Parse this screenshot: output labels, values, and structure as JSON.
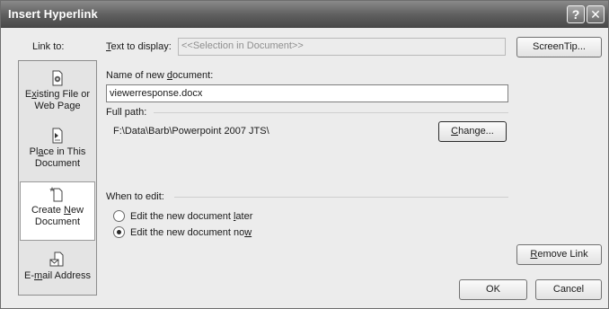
{
  "window": {
    "title": "Insert Hyperlink",
    "help_glyph": "?",
    "close_glyph": "✕"
  },
  "link_to": {
    "label": "Link to:",
    "items": [
      {
        "label_lines": [
          "Existing File or",
          "Web Page"
        ],
        "underline_char": "x",
        "icon": "existing-file-icon",
        "selected": false
      },
      {
        "label_lines": [
          "Place in This",
          "Document"
        ],
        "underline_char": "a",
        "icon": "place-in-document-icon",
        "selected": false
      },
      {
        "label_lines": [
          "Create New",
          "Document"
        ],
        "underline_char": "N",
        "icon": "new-document-icon",
        "selected": true
      },
      {
        "label_lines": [
          "E-mail Address"
        ],
        "underline_char": "m",
        "icon": "email-address-icon",
        "selected": false
      }
    ]
  },
  "text_to_display": {
    "label": "Text to display:",
    "value": "<<Selection in Document>>"
  },
  "buttons": {
    "screentip": "ScreenTip...",
    "change": "Change...",
    "remove_link": "Remove Link",
    "ok": "OK",
    "cancel": "Cancel"
  },
  "new_document": {
    "name_label": "Name of new document:",
    "name_value": "viewerresponse.docx",
    "full_path_label": "Full path:",
    "full_path_value": "F:\\Data\\Barb\\Powerpoint 2007 JTS\\"
  },
  "when_to_edit": {
    "label": "When to edit:",
    "options": [
      {
        "label": "Edit the new document later",
        "checked": false
      },
      {
        "label": "Edit the new document now",
        "checked": true
      }
    ]
  }
}
